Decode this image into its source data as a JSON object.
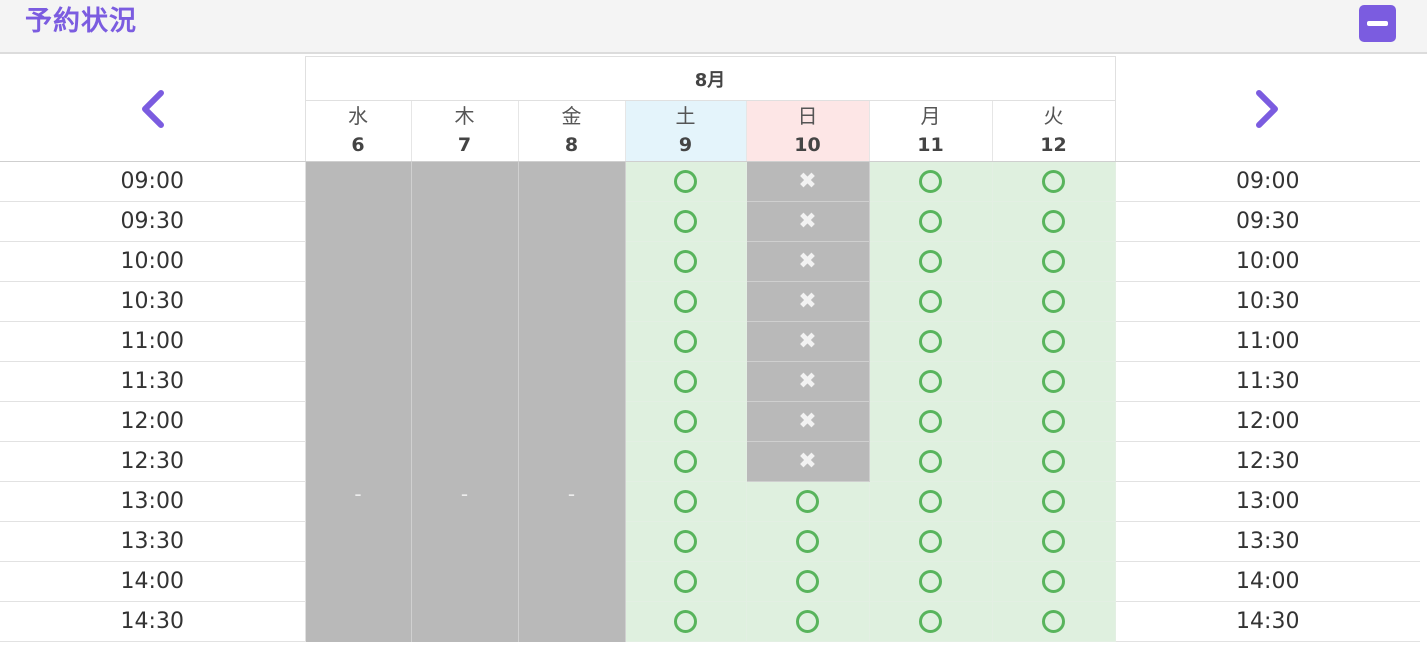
{
  "header": {
    "title": "予約状況"
  },
  "calendar": {
    "month": "8月",
    "days": [
      {
        "weekday": "水",
        "date": "6"
      },
      {
        "weekday": "木",
        "date": "7"
      },
      {
        "weekday": "金",
        "date": "8"
      },
      {
        "weekday": "土",
        "date": "9"
      },
      {
        "weekday": "日",
        "date": "10"
      },
      {
        "weekday": "月",
        "date": "11"
      },
      {
        "weekday": "火",
        "date": "12"
      }
    ],
    "closed_mark": "-",
    "available_mark": "○",
    "full_mark": "✖",
    "times": [
      "09:00",
      "09:30",
      "10:00",
      "10:30",
      "11:00",
      "11:30",
      "12:00",
      "12:30",
      "13:00",
      "13:30",
      "14:00",
      "14:30"
    ],
    "slots": [
      [
        "avail",
        "full",
        "avail",
        "avail"
      ],
      [
        "avail",
        "full",
        "avail",
        "avail"
      ],
      [
        "avail",
        "full",
        "avail",
        "avail"
      ],
      [
        "avail",
        "full",
        "avail",
        "avail"
      ],
      [
        "avail",
        "full",
        "avail",
        "avail"
      ],
      [
        "avail",
        "full",
        "avail",
        "avail"
      ],
      [
        "avail",
        "full",
        "avail",
        "avail"
      ],
      [
        "avail",
        "full",
        "avail",
        "avail"
      ],
      [
        "avail",
        "avail",
        "avail",
        "avail"
      ],
      [
        "avail",
        "avail",
        "avail",
        "avail"
      ],
      [
        "avail",
        "avail",
        "avail",
        "avail"
      ],
      [
        "avail",
        "avail",
        "avail",
        "avail"
      ]
    ]
  },
  "colors": {
    "accent": "#7b5ce0",
    "available": "#58b45c",
    "closed": "#b9b9b9"
  },
  "icons": {
    "prev": "chevron-left-icon",
    "next": "chevron-right-icon",
    "collapse": "minus-icon"
  }
}
